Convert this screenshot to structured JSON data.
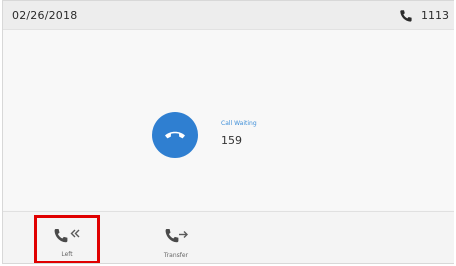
{
  "status_bar": {
    "date": "02/26/2018",
    "time": "1113",
    "phone_icon": "phone-icon"
  },
  "call": {
    "state": "Call Waiting",
    "number": "159",
    "action_icon": "hang-up-icon",
    "accent_color": "#2f7fd1"
  },
  "softkeys": [
    {
      "label": "Left",
      "icon": "phone-back-icon",
      "highlighted": true,
      "highlight_color": "#e00000"
    },
    {
      "label": "Transfer",
      "icon": "phone-transfer-icon",
      "highlighted": false
    }
  ]
}
